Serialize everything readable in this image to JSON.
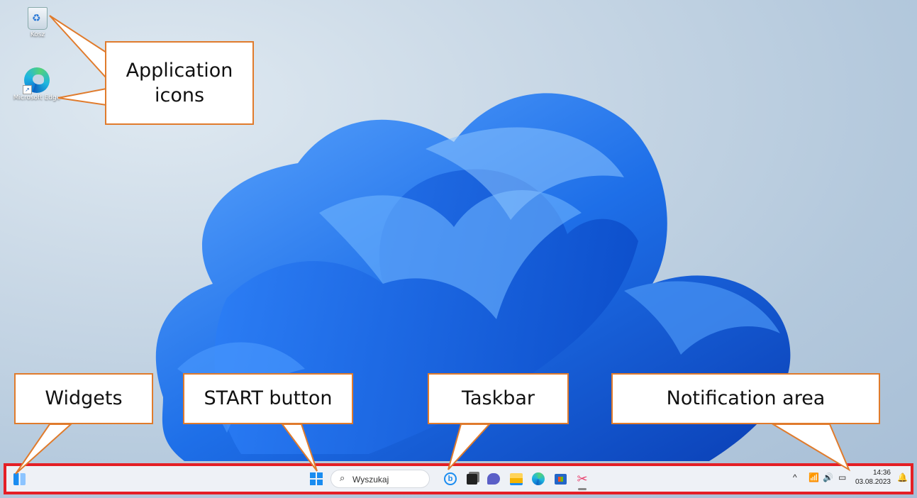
{
  "desktop": {
    "icons": [
      {
        "label": "Kosz",
        "icon": "recycle-bin-icon"
      },
      {
        "label": "Microsoft Edge",
        "icon": "edge-icon"
      }
    ]
  },
  "callouts": {
    "application_icons": "Application icons",
    "widgets": "Widgets",
    "start_button": "START button",
    "taskbar": "Taskbar",
    "notification_area": "Notification area"
  },
  "taskbar": {
    "search_placeholder": "Wyszukaj",
    "apps": [
      "bing-icon",
      "task-view-icon",
      "teams-chat-icon",
      "file-explorer-icon",
      "edge-icon",
      "store-icon",
      "snipping-tool-icon"
    ],
    "clock_time": "14:36",
    "clock_date": "03.08.2023"
  },
  "colors": {
    "callout_border": "#e07b2c",
    "taskbar_highlight": "#e41f25",
    "accent": "#1a8cf0"
  }
}
